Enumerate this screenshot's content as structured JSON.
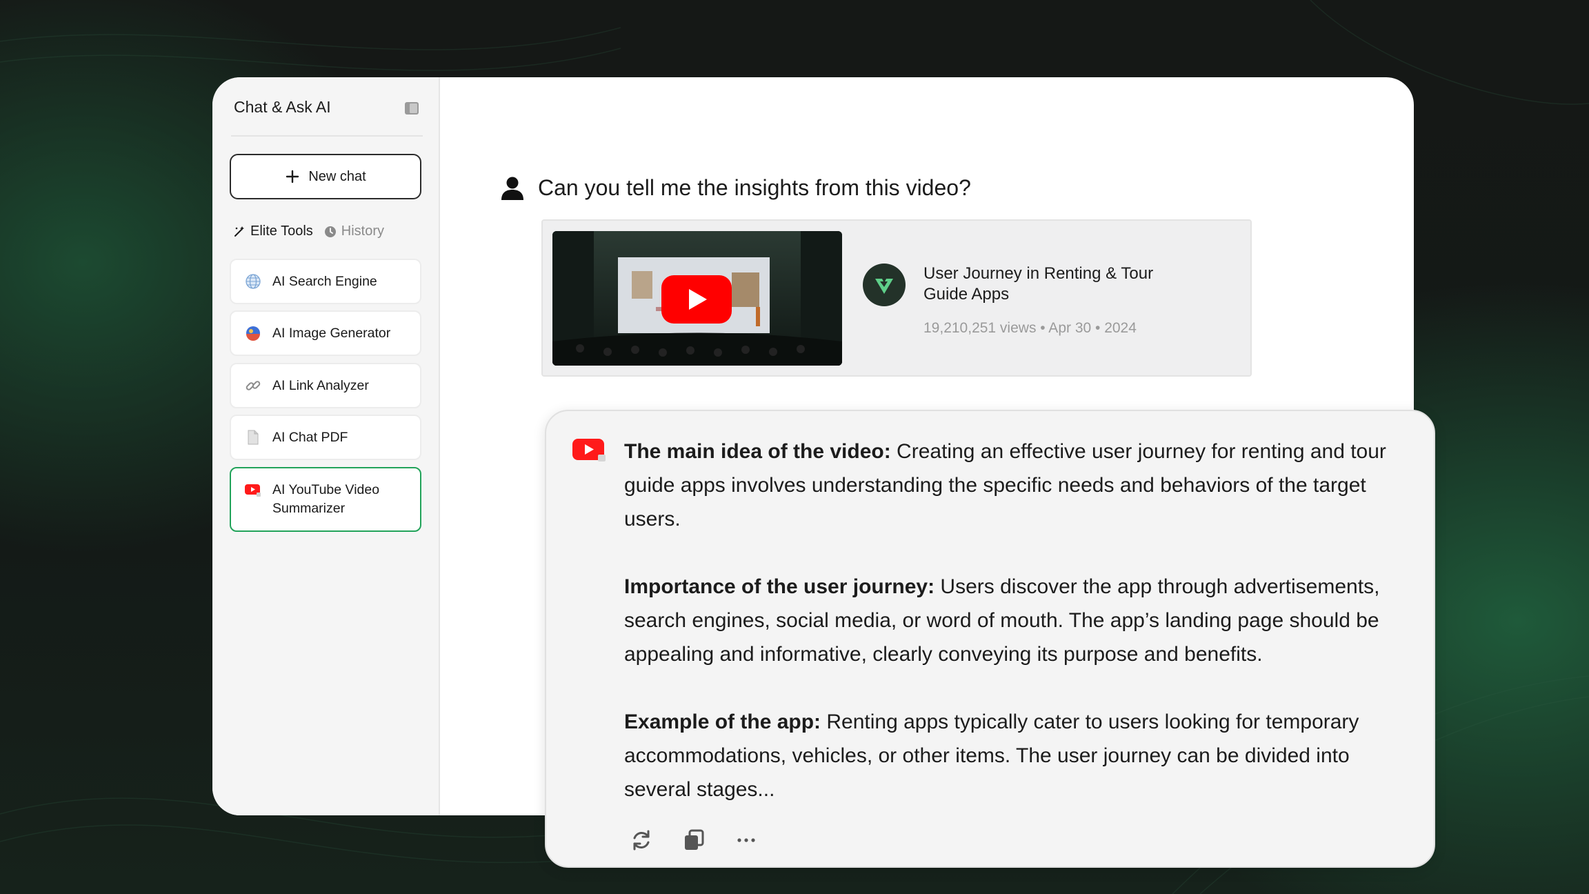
{
  "app": {
    "title": "Chat & Ask AI"
  },
  "sidebar": {
    "new_chat_label": "New chat",
    "tabs": [
      {
        "label": "Elite Tools",
        "icon": "magic-wand-icon",
        "active": true
      },
      {
        "label": "History",
        "icon": "clock-icon",
        "active": false
      }
    ],
    "tools": [
      {
        "label": "AI Search Engine",
        "icon": "globe-icon",
        "selected": false
      },
      {
        "label": "AI Image Generator",
        "icon": "image-generator-icon",
        "selected": false
      },
      {
        "label": "AI Link Analyzer",
        "icon": "link-icon",
        "selected": false
      },
      {
        "label": "AI Chat PDF",
        "icon": "document-icon",
        "selected": false
      },
      {
        "label": "AI YouTube Video Summarizer",
        "icon": "youtube-icon",
        "selected": true
      }
    ]
  },
  "chat": {
    "user_question": "Can you tell me the insights from this video?",
    "video": {
      "title": "User Journey in Renting & Tour Guide Apps",
      "meta": "19,210,251 views • Apr 30 • 2024"
    },
    "answer": [
      {
        "heading": "The main idea of the video:",
        "text": " Creating an effective user journey for renting and tour guide apps involves understanding the specific needs and behaviors of the target users."
      },
      {
        "heading": "Importance of the user journey:",
        "text": " Users discover the app through advertisements, search engines, social media, or word of mouth. The app’s landing page should be appealing and informative, clearly conveying its purpose and benefits."
      },
      {
        "heading": "Example of the app:",
        "text": " Renting apps typically cater to users looking for temporary accommodations, vehicles, or other items. The user journey can be divided into several stages..."
      }
    ],
    "actions": [
      "regenerate-icon",
      "copy-icon",
      "more-icon"
    ]
  },
  "colors": {
    "accent_green": "#22a35a",
    "youtube_red": "#ff0000",
    "background": "#151816"
  }
}
